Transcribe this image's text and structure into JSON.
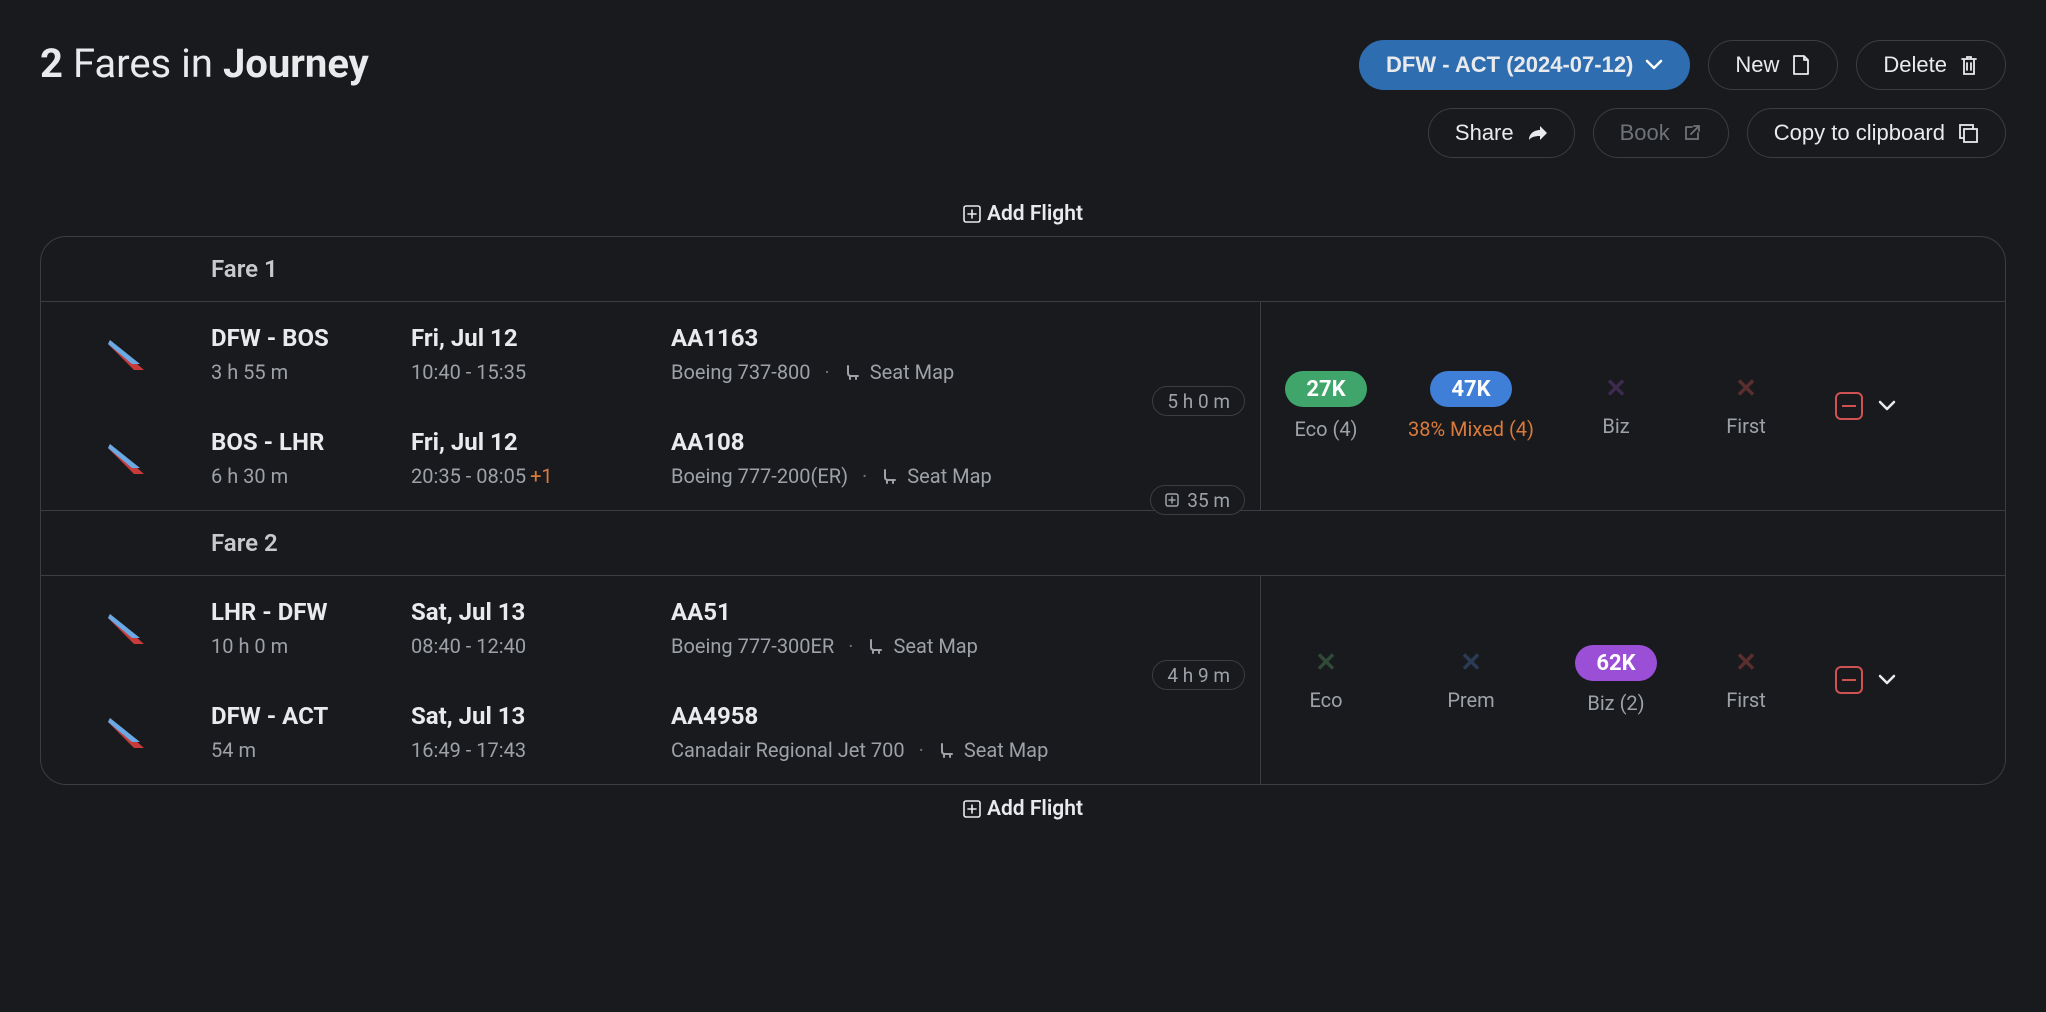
{
  "header": {
    "count": "2",
    "fares_in": "Fares in",
    "journey": "Journey",
    "journey_select": "DFW - ACT (2024-07-12)",
    "new_label": "New",
    "delete_label": "Delete",
    "share_label": "Share",
    "book_label": "Book",
    "copy_label": "Copy to clipboard"
  },
  "add_flight_label": "Add Flight",
  "fares": [
    {
      "label": "Fare 1",
      "gap_mid": "5 h 0 m",
      "gap_end": "35 m",
      "segments": [
        {
          "route": "DFW - BOS",
          "duration": "3 h 55 m",
          "date": "Fri, Jul 12",
          "times": "10:40 - 15:35",
          "next_day": "",
          "flight": "AA1163",
          "aircraft": "Boeing 737-800",
          "seat_map": "Seat Map"
        },
        {
          "route": "BOS - LHR",
          "duration": "6 h 30 m",
          "date": "Fri, Jul 12",
          "times": "20:35 - 08:05",
          "next_day": "+1",
          "flight": "AA108",
          "aircraft": "Boeing 777-200(ER)",
          "seat_map": "Seat Map"
        }
      ],
      "avail": {
        "eco": {
          "points": "27K",
          "label": "Eco (4)"
        },
        "mixed": {
          "points": "47K",
          "label": "38% Mixed (4)"
        },
        "biz": {
          "label": "Biz"
        },
        "first": {
          "label": "First"
        }
      }
    },
    {
      "label": "Fare 2",
      "gap_mid": "4 h 9 m",
      "gap_end": "",
      "segments": [
        {
          "route": "LHR - DFW",
          "duration": "10 h 0 m",
          "date": "Sat, Jul 13",
          "times": "08:40 - 12:40",
          "next_day": "",
          "flight": "AA51",
          "aircraft": "Boeing 777-300ER",
          "seat_map": "Seat Map"
        },
        {
          "route": "DFW - ACT",
          "duration": "54 m",
          "date": "Sat, Jul 13",
          "times": "16:49 - 17:43",
          "next_day": "",
          "flight": "AA4958",
          "aircraft": "Canadair Regional Jet 700",
          "seat_map": "Seat Map"
        }
      ],
      "avail": {
        "eco": {
          "label": "Eco"
        },
        "prem": {
          "label": "Prem"
        },
        "biz": {
          "points": "62K",
          "label": "Biz (2)"
        },
        "first": {
          "label": "First"
        }
      }
    }
  ]
}
